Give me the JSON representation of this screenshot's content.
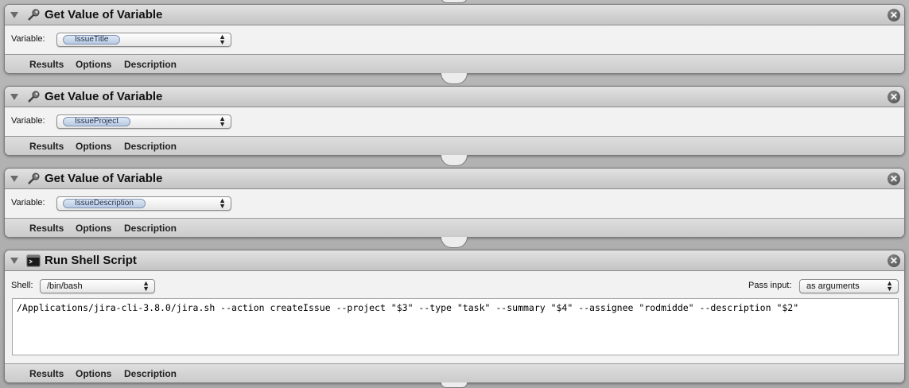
{
  "actions": [
    {
      "title": "Get Value of Variable",
      "icon": "variable-wrench-icon",
      "variable_label": "Variable:",
      "variable_value": "IssueTitle",
      "tabs": [
        "Results",
        "Options",
        "Description"
      ]
    },
    {
      "title": "Get Value of Variable",
      "icon": "variable-wrench-icon",
      "variable_label": "Variable:",
      "variable_value": "IssueProject",
      "tabs": [
        "Results",
        "Options",
        "Description"
      ]
    },
    {
      "title": "Get Value of Variable",
      "icon": "variable-wrench-icon",
      "variable_label": "Variable:",
      "variable_value": "IssueDescription",
      "tabs": [
        "Results",
        "Options",
        "Description"
      ]
    },
    {
      "title": "Run Shell Script",
      "icon": "terminal-icon",
      "shell_label": "Shell:",
      "shell_value": "/bin/bash",
      "pass_input_label": "Pass input:",
      "pass_input_value": "as arguments",
      "script": "/Applications/jira-cli-3.8.0/jira.sh --action createIssue --project \"$3\" --type \"task\" --summary \"$4\" --assignee \"rodmidde\" --description \"$2\"",
      "tabs": [
        "Results",
        "Options",
        "Description"
      ]
    }
  ],
  "close_glyph": "✕",
  "popup_arrows": [
    "▲",
    "▼"
  ]
}
